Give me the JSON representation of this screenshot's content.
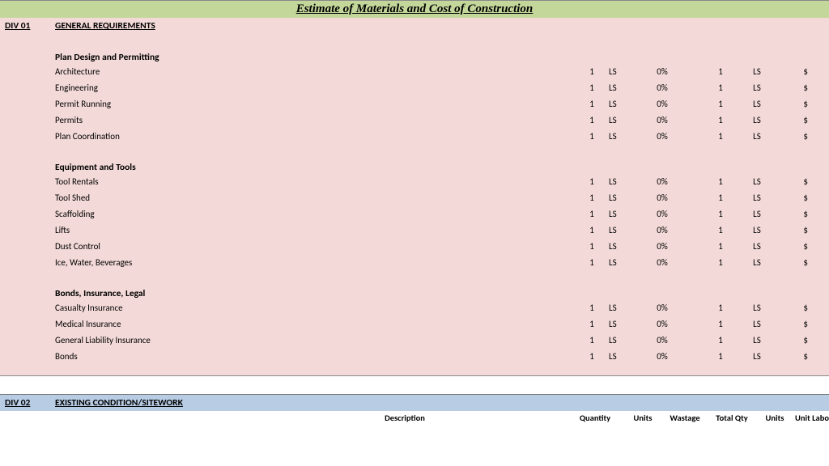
{
  "title": "Estimate of Materials and Cost of Construction",
  "div01": {
    "code": "DIV 01",
    "name": "GENERAL REQUIREMENTS",
    "groups": [
      {
        "title": "Plan Design and Permitting",
        "items": [
          {
            "desc": "Architecture",
            "qty": "1",
            "units": "LS",
            "wastage": "0%",
            "totalqty": "1",
            "units2": "LS",
            "cost": "$"
          },
          {
            "desc": "Engineering",
            "qty": "1",
            "units": "LS",
            "wastage": "0%",
            "totalqty": "1",
            "units2": "LS",
            "cost": "$"
          },
          {
            "desc": "Permit Running",
            "qty": "1",
            "units": "LS",
            "wastage": "0%",
            "totalqty": "1",
            "units2": "LS",
            "cost": "$"
          },
          {
            "desc": "Permits",
            "qty": "1",
            "units": "LS",
            "wastage": "0%",
            "totalqty": "1",
            "units2": "LS",
            "cost": "$"
          },
          {
            "desc": "Plan Coordination",
            "qty": "1",
            "units": "LS",
            "wastage": "0%",
            "totalqty": "1",
            "units2": "LS",
            "cost": "$"
          }
        ]
      },
      {
        "title": "Equipment and Tools",
        "items": [
          {
            "desc": "Tool Rentals",
            "qty": "1",
            "units": "LS",
            "wastage": "0%",
            "totalqty": "1",
            "units2": "LS",
            "cost": "$"
          },
          {
            "desc": "Tool Shed",
            "qty": "1",
            "units": "LS",
            "wastage": "0%",
            "totalqty": "1",
            "units2": "LS",
            "cost": "$"
          },
          {
            "desc": "Scaffolding",
            "qty": "1",
            "units": "LS",
            "wastage": "0%",
            "totalqty": "1",
            "units2": "LS",
            "cost": "$"
          },
          {
            "desc": "Lifts",
            "qty": "1",
            "units": "LS",
            "wastage": "0%",
            "totalqty": "1",
            "units2": "LS",
            "cost": "$"
          },
          {
            "desc": "Dust Control",
            "qty": "1",
            "units": "LS",
            "wastage": "0%",
            "totalqty": "1",
            "units2": "LS",
            "cost": "$"
          },
          {
            "desc": "Ice, Water, Beverages",
            "qty": "1",
            "units": "LS",
            "wastage": "0%",
            "totalqty": "1",
            "units2": "LS",
            "cost": "$"
          }
        ]
      },
      {
        "title": "Bonds, Insurance, Legal",
        "items": [
          {
            "desc": "Casualty Insurance",
            "qty": "1",
            "units": "LS",
            "wastage": "0%",
            "totalqty": "1",
            "units2": "LS",
            "cost": "$"
          },
          {
            "desc": "Medical Insurance",
            "qty": "1",
            "units": "LS",
            "wastage": "0%",
            "totalqty": "1",
            "units2": "LS",
            "cost": "$"
          },
          {
            "desc": "General Liability Insurance",
            "qty": "1",
            "units": "LS",
            "wastage": "0%",
            "totalqty": "1",
            "units2": "LS",
            "cost": "$"
          },
          {
            "desc": "Bonds",
            "qty": "1",
            "units": "LS",
            "wastage": "0%",
            "totalqty": "1",
            "units2": "LS",
            "cost": "$"
          }
        ]
      }
    ]
  },
  "div02": {
    "code": "DIV 02",
    "name": "EXISTING CONDITION/SITEWORK"
  },
  "column_labels": {
    "description": "Description",
    "quantity": "Quantity",
    "units": "Units",
    "wastage": "Wastage",
    "totalqty": "Total Qty",
    "units2": "Units",
    "unitlabor": "Unit Labo"
  }
}
